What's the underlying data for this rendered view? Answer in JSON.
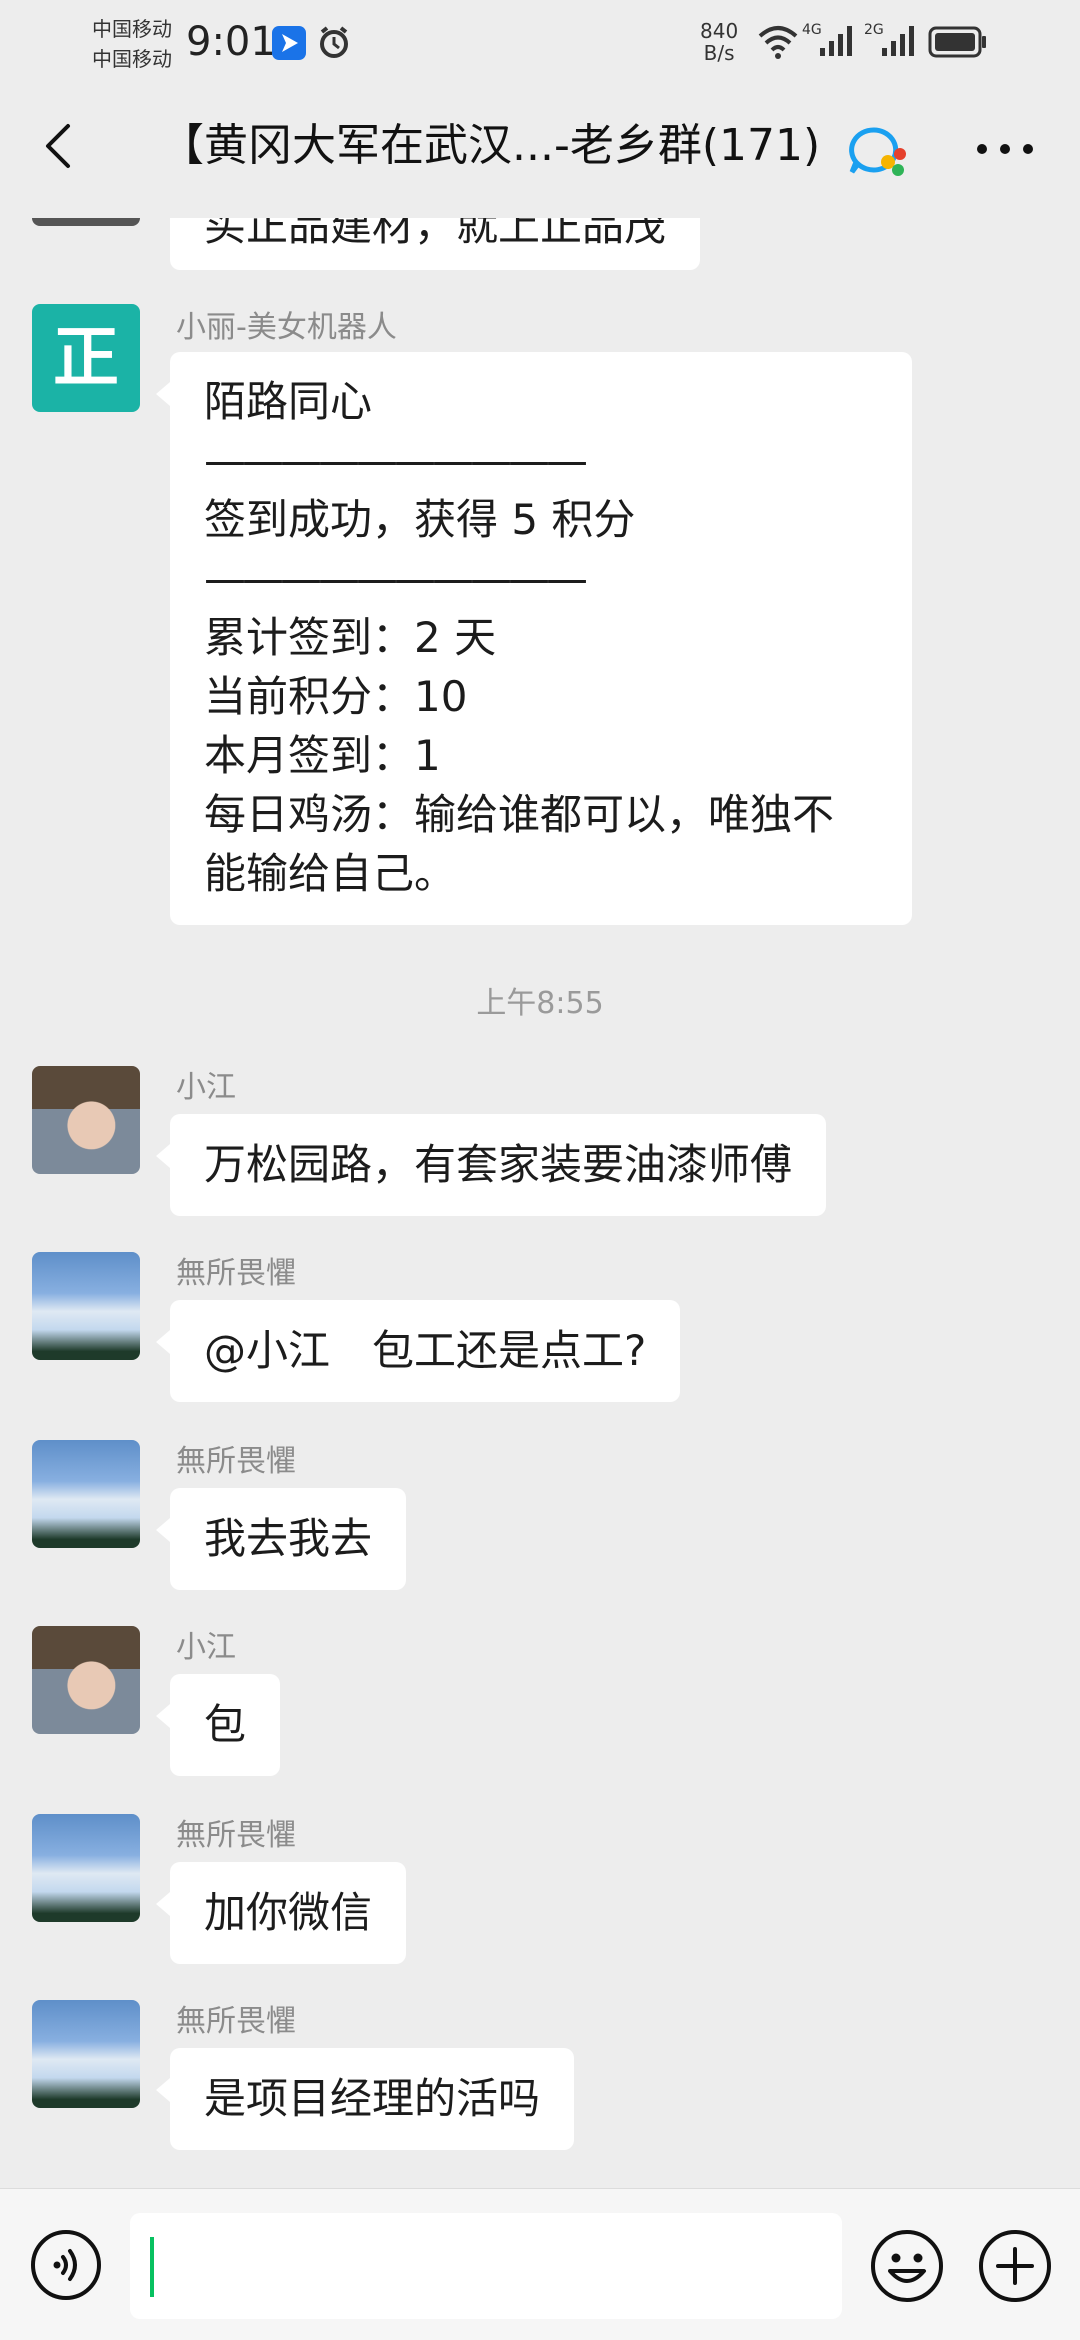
{
  "status_bar": {
    "carrier_1": "中国移动",
    "carrier_2": "中国移动",
    "time": "9:01",
    "net_speed_value": "840",
    "net_speed_unit": "B/s",
    "signal_1_label": "4G",
    "signal_2_label": "2G",
    "icons": [
      "location-arrow-icon",
      "alarm-icon",
      "wifi-icon",
      "signal-icon",
      "battery-icon"
    ]
  },
  "header": {
    "title": "【黄冈大军在武汉...-老乡群(171)",
    "back_icon": "chevron-left-icon",
    "badge_icon": "chat-bubble-icon",
    "more_icon": "more-dots-icon"
  },
  "messages": {
    "partial": {
      "text": "买正品建材，就上正品茂"
    },
    "bot": {
      "sender": "小丽-美女机器人",
      "avatar_char": "正",
      "lines": [
        "陌路同心",
        "——————————",
        "签到成功，获得 5 积分",
        "——————————",
        "累计签到：2 天",
        "当前积分：10",
        "本月签到：1",
        "每日鸡汤：输给谁都可以，唯独不",
        "能输给自己。"
      ]
    },
    "timestamp": "上午8:55",
    "list": [
      {
        "sender": "小江",
        "text": "万松园路，有套家装要油漆师傅",
        "avatar": "face"
      },
      {
        "sender": "無所畏懼",
        "text": "@小江　包工还是点工?",
        "avatar": "sky"
      },
      {
        "sender": "無所畏懼",
        "text": "我去我去",
        "avatar": "sky"
      },
      {
        "sender": "小江",
        "text": "包",
        "avatar": "face"
      },
      {
        "sender": "無所畏懼",
        "text": "加你微信",
        "avatar": "sky"
      },
      {
        "sender": "無所畏懼",
        "text": "是项目经理的活吗",
        "avatar": "sky"
      }
    ]
  },
  "input_bar": {
    "placeholder": "",
    "voice_icon": "voice-icon",
    "emoji_icon": "emoji-icon",
    "plus_icon": "plus-circle-icon"
  },
  "colors": {
    "background": "#ededed",
    "bubble": "#ffffff",
    "accent_green": "#07c160",
    "timestamp": "#9a9a9a",
    "sender_name": "#8b8b8b"
  }
}
